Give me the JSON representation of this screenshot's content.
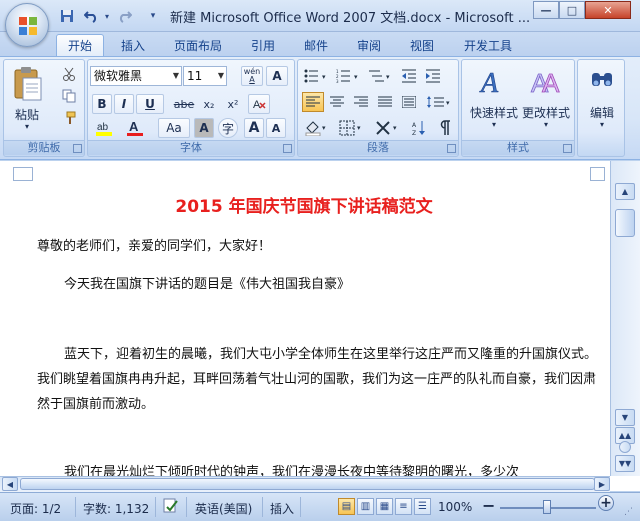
{
  "window": {
    "title": "新建 Microsoft Office Word 2007 文档.docx - Microsoft ...",
    "minimize_glyph": "—",
    "maximize_glyph": "□",
    "close_glyph": "✕"
  },
  "qat": {
    "save_icon": "save-icon",
    "undo_icon": "undo-icon",
    "redo_icon": "redo-icon",
    "customize_icon": "chevron-down-icon"
  },
  "tabs": [
    {
      "label": "开始",
      "active": true
    },
    {
      "label": "插入"
    },
    {
      "label": "页面布局"
    },
    {
      "label": "引用"
    },
    {
      "label": "邮件"
    },
    {
      "label": "审阅"
    },
    {
      "label": "视图"
    },
    {
      "label": "开发工具"
    }
  ],
  "ribbon": {
    "clipboard": {
      "label": "剪贴板",
      "paste": "粘贴"
    },
    "font": {
      "label": "字体",
      "font_name": "微软雅黑",
      "font_size": "11",
      "bold": "B",
      "italic": "I",
      "underline": "U",
      "strike": "abe",
      "subscript": "x₂",
      "superscript": "x²",
      "change_case": "Aa",
      "grow": "A",
      "shrink": "A",
      "wen": "wén",
      "char_border": "A",
      "char_shade": "A",
      "enclose": "字"
    },
    "paragraph": {
      "label": "段落"
    },
    "styles": {
      "label": "样式",
      "quick_styles": "快速样式",
      "change_styles": "更改样式"
    },
    "editing": {
      "label": "编辑"
    }
  },
  "document": {
    "heading": "2015 年国庆节国旗下讲话稿范文",
    "paragraphs": [
      "尊敬的老师们，亲爱的同学们，大家好！",
      "今天我在国旗下讲话的题目是《伟大祖国我自豪》",
      "蓝天下，迎着初生的晨曦，我们大屯小学全体师生在这里举行这庄严而又隆重的升国旗仪式。我们眺望着国旗冉冉升起，耳畔回荡着气壮山河的国歌，我们为这一庄严的队礼而自豪，我们因肃然于国旗前而激动。",
      "我们在晨光灿烂下倾听时代的钟声，我们在漫漫长夜中等待黎明的曙光，多少次"
    ]
  },
  "status": {
    "page": "页面: 1/2",
    "words": "字数: 1,132",
    "language": "英语(美国)",
    "insert_mode": "插入",
    "zoom": "100%",
    "zoom_out": "−",
    "zoom_in": "+"
  },
  "colors": {
    "heading": "#e8201e",
    "accent": "#15428b",
    "highlight": "#ffff00",
    "font_color": "#e81e1e"
  }
}
